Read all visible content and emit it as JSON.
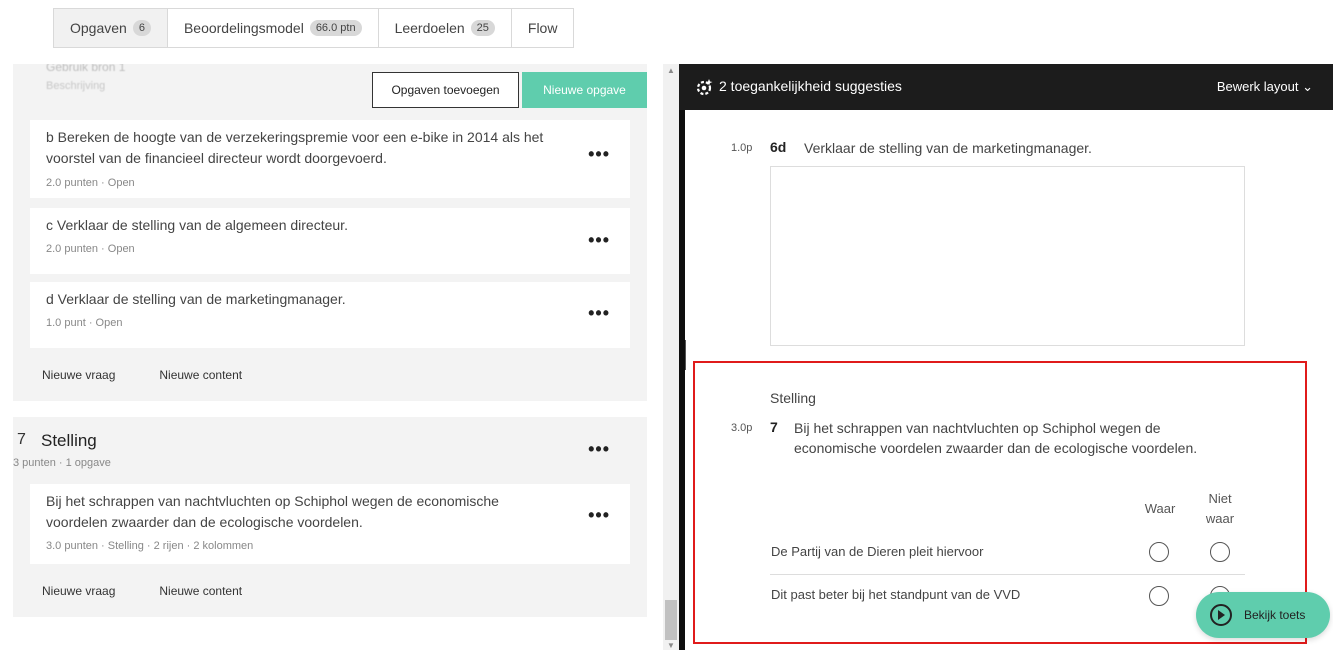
{
  "tabs": [
    {
      "label": "Opgaven",
      "badge": "6"
    },
    {
      "label": "Beoordelingsmodel",
      "badge": "66.0 ptn"
    },
    {
      "label": "Leerdoelen",
      "badge": "25"
    },
    {
      "label": "Flow"
    }
  ],
  "left": {
    "faded_title": "Gebruik bron 1",
    "faded_sub": "Beschrijving",
    "add_exercises_label": "Opgaven toevoegen",
    "new_exercise_label": "Nieuwe opgave",
    "questions": [
      {
        "text": "b  Bereken de hoogte van de verzekeringspremie voor een e-bike in 2014 als het voorstel van de financieel directeur wordt doorgevoerd.",
        "meta": "2.0 punten · Open"
      },
      {
        "text": "c  Verklaar de stelling van de algemeen directeur.",
        "meta": "2.0 punten · Open"
      },
      {
        "text": "d  Verklaar de stelling van de marketingmanager.",
        "meta": "1.0 punt · Open"
      }
    ],
    "new_question_label": "Nieuwe vraag",
    "new_content_label": "Nieuwe content",
    "stelling": {
      "number": "7",
      "title": "Stelling",
      "meta": "3 punten · 1 opgave",
      "question_text": "Bij het schrappen van nachtvluchten op Schiphol wegen de economische voordelen zwaarder dan de ecologische voordelen.",
      "question_meta": "3.0 punten · Stelling · 2 rijen · 2 kolommen"
    }
  },
  "preview": {
    "title": "2 toegankelijkheid suggesties",
    "layout_label": "Bewerk layout",
    "q6": {
      "points": "1.0p",
      "number": "6d",
      "text": "Verklaar de stelling van de marketingmanager."
    },
    "q7": {
      "heading": "Stelling",
      "points": "3.0p",
      "number": "7",
      "text": "Bij het schrappen van nachtvluchten op Schiphol wegen de economische voordelen zwaarder dan de ecologische voordelen.",
      "col_true": "Waar",
      "col_false_1": "Niet",
      "col_false_2": "waar",
      "rows": [
        "De Partij van de Dieren pleit hiervoor",
        "Dit past beter bij het standpunt van de VVD"
      ]
    },
    "view_test_label": "Bekijk toets"
  },
  "colors": {
    "accent": "#5fcdad",
    "highlight": "#e01b1b",
    "header": "#1c1c1c"
  }
}
